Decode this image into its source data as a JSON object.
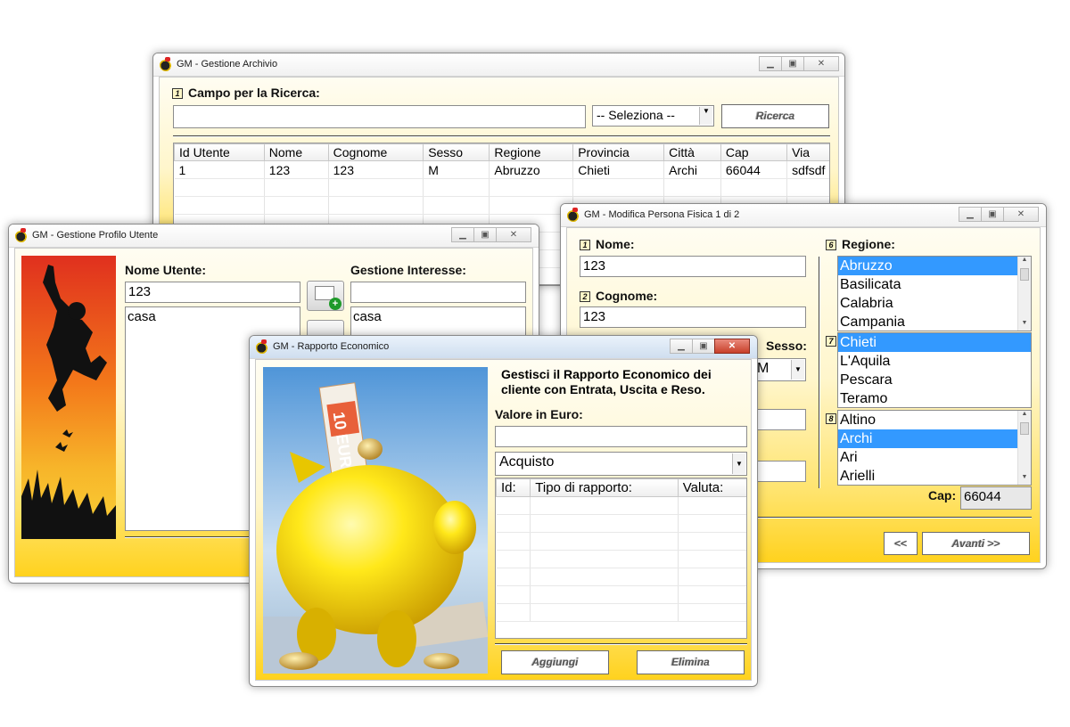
{
  "archive": {
    "title": "GM - Gestione Archivio",
    "search_label": "Campo per la Ricerca:",
    "search_number": "1",
    "search_value": "",
    "select_value": "-- Seleziona --",
    "search_button": "Ricerca",
    "columns": [
      "Id Utente",
      "Nome",
      "Cognome",
      "Sesso",
      "Regione",
      "Provincia",
      "Città",
      "Cap",
      "Via"
    ],
    "rows": [
      [
        "1",
        "123",
        "123",
        "M",
        "Abruzzo",
        "Chieti",
        "Archi",
        "66044",
        "sdfsdf"
      ]
    ]
  },
  "profile": {
    "title": "GM - Gestione Profilo Utente",
    "username_label": "Nome Utente:",
    "username_value": "123",
    "user_list": [
      "casa"
    ],
    "interests_label": "Gestione Interesse:",
    "interest_value": "",
    "interest_list": [
      "casa"
    ]
  },
  "person": {
    "title": "GM - Modifica Persona Fisica 1 di 2",
    "nome_label": "Nome:",
    "nome_number": "1",
    "nome_value": "123",
    "cognome_label": "Cognome:",
    "cognome_number": "2",
    "cognome_value": "123",
    "sesso_label": "Sesso:",
    "sesso_value": "M",
    "regione_label": "Regione:",
    "regione_number": "6",
    "regioni": [
      "Abruzzo",
      "Basilicata",
      "Calabria",
      "Campania"
    ],
    "regione_selected": 0,
    "provincia_number": "7",
    "province": [
      "Chieti",
      "L'Aquila",
      "Pescara",
      "Teramo"
    ],
    "provincia_selected": 0,
    "citta_number": "8",
    "citta": [
      "Altino",
      "Archi",
      "Ari",
      "Arielli"
    ],
    "citta_selected": 1,
    "cap_label": "Cap:",
    "cap_value": "66044",
    "back_button": "<<",
    "next_button": "Avanti >>"
  },
  "economic": {
    "title": "GM - Rapporto Economico",
    "heading": "Gestisci il Rapporto Economico dei cliente con Entrata, Uscita e Reso.",
    "value_label": "Valore in Euro:",
    "value_input": "",
    "type_value": "Acquisto",
    "columns": [
      "Id:",
      "Tipo di rapporto:",
      "Valuta:"
    ],
    "add_button": "Aggiungi",
    "delete_button": "Elimina"
  },
  "colors": {
    "selection": "#3399ff",
    "window_gradient_end": "#ffd21e"
  }
}
